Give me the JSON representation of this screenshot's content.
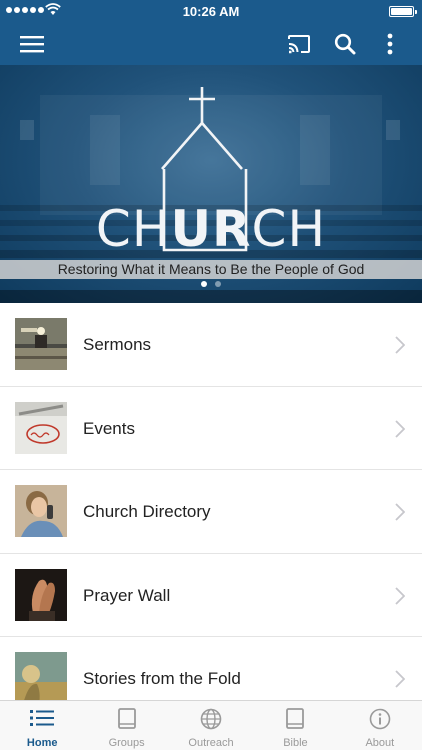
{
  "status_bar": {
    "time": "10:26 AM"
  },
  "app_bar": {
    "icons": [
      "menu-icon",
      "cast-icon",
      "search-icon",
      "more-vertical-icon"
    ]
  },
  "banner": {
    "wordmark_left": "CH",
    "wordmark_mid": "UR",
    "wordmark_right": "CH",
    "tagline": "Restoring What it Means to Be the People of God",
    "slides": 2,
    "active_slide": 1
  },
  "menu": {
    "items": [
      {
        "label": "Sermons",
        "thumb": "sermons-thumbnail"
      },
      {
        "label": "Events",
        "thumb": "events-thumbnail"
      },
      {
        "label": "Church Directory",
        "thumb": "directory-thumbnail"
      },
      {
        "label": "Prayer Wall",
        "thumb": "prayer-thumbnail"
      },
      {
        "label": "Stories from the Fold",
        "thumb": "stories-thumbnail"
      }
    ],
    "stories_thumb_text": "Stories from the Fold"
  },
  "tab_bar": {
    "tabs": [
      {
        "label": "Home",
        "icon": "list-icon"
      },
      {
        "label": "Groups",
        "icon": "book-icon"
      },
      {
        "label": "Outreach",
        "icon": "globe-icon"
      },
      {
        "label": "Bible",
        "icon": "book-icon"
      },
      {
        "label": "About",
        "icon": "info-icon"
      }
    ],
    "active": "Home"
  },
  "colors": {
    "brand": "#1b5a8c",
    "tab_active": "#1b5a8c",
    "tab_inactive": "#9a9a9a"
  }
}
